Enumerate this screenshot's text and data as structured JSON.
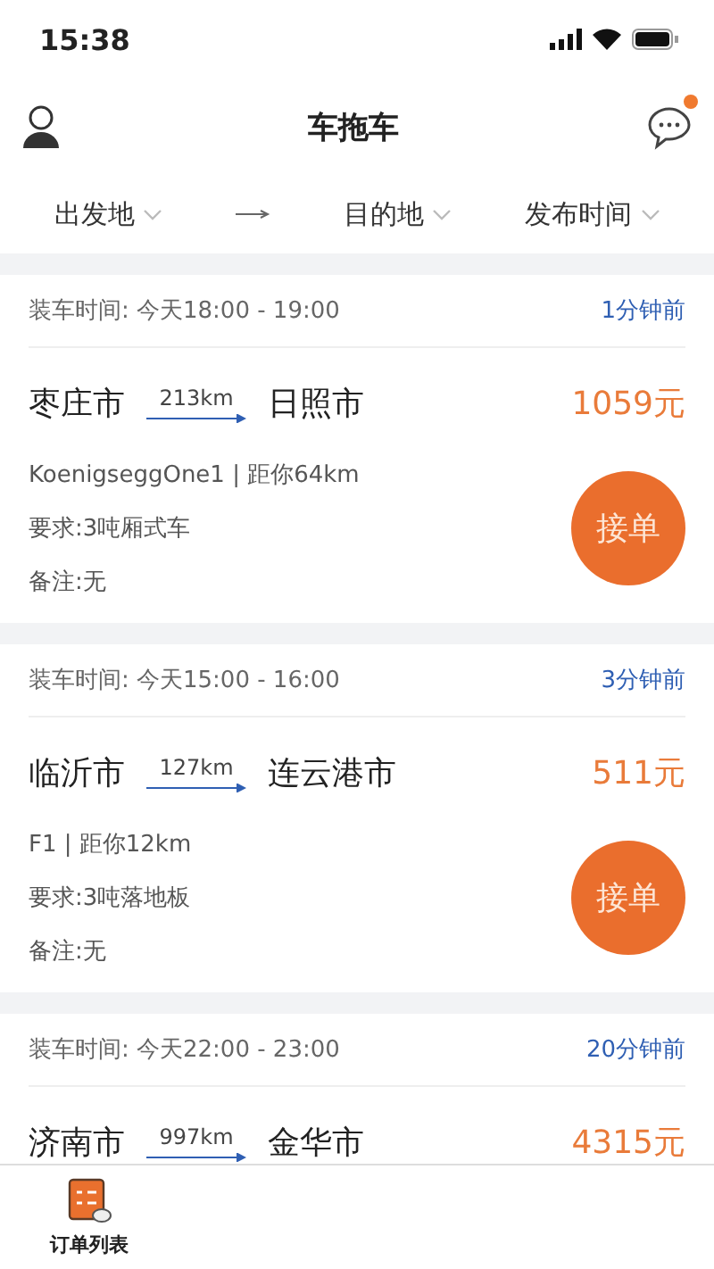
{
  "status_bar": {
    "time": "15:38"
  },
  "header": {
    "title": "车拖车",
    "has_unread": true
  },
  "filters": [
    {
      "label": "出发地",
      "kind": "dropdown"
    },
    {
      "kind": "arrow"
    },
    {
      "label": "目的地",
      "kind": "dropdown"
    },
    {
      "label": "发布时间",
      "kind": "dropdown"
    }
  ],
  "orders": [
    {
      "load_time": "装车时间: 今天18:00 - 19:00",
      "posted": "1分钟前",
      "from": "枣庄市",
      "distance": "213km",
      "to": "日照市",
      "price": "1059元",
      "shipper": "KoenigseggOne1 | 距你64km",
      "requirement": "要求:3吨厢式车",
      "note": "备注:无",
      "action": "接单"
    },
    {
      "load_time": "装车时间: 今天15:00 - 16:00",
      "posted": "3分钟前",
      "from": "临沂市",
      "distance": "127km",
      "to": "连云港市",
      "price": "511元",
      "shipper": "F1 | 距你12km",
      "requirement": "要求:3吨落地板",
      "note": "备注:无",
      "action": "接单"
    },
    {
      "load_time": "装车时间: 今天22:00 - 23:00",
      "posted": "20分钟前",
      "from": "济南市",
      "distance": "997km",
      "to": "金华市",
      "price": "4315元"
    }
  ],
  "tab_bar": [
    {
      "label": "订单列表",
      "selected": true
    }
  ]
}
